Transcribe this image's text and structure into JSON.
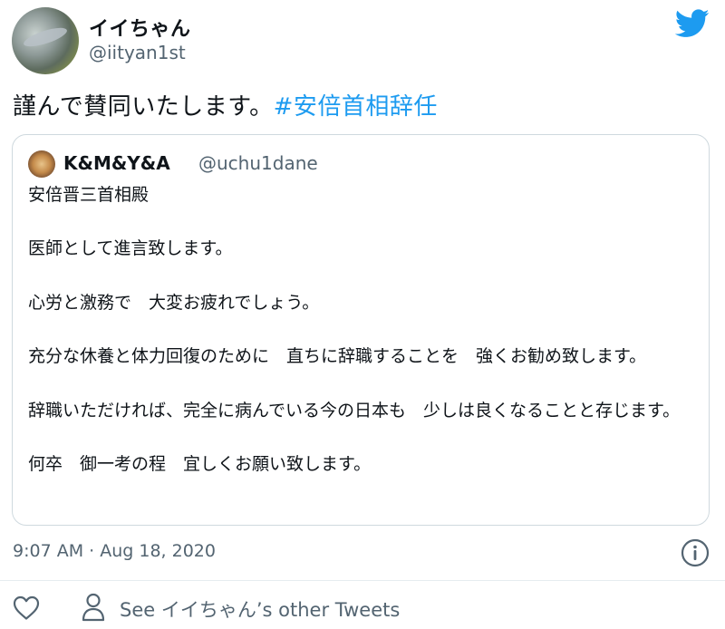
{
  "author": {
    "display_name": "イイちゃん",
    "handle": "@iityan1st"
  },
  "tweet": {
    "text": "謹んで賛同いたします。",
    "hashtag": "#安倍首相辞任"
  },
  "quoted_tweet": {
    "display_name": "K&M&Y&A",
    "handle": "@uchu1dane",
    "body": "安倍晋三首相殿\n\n医師として進言致します。\n\n心労と激務で　大変お疲れでしょう。\n\n充分な休養と体力回復のために　直ちに辞職することを　強くお勧め致します。\n\n辞職いただければ、完全に病んでいる今の日本も　少しは良くなることと存じます。\n\n何卒　御一考の程　宜しくお願い致します。"
  },
  "timestamp": "9:07 AM · Aug 18, 2020",
  "footer": {
    "see_tweets": "See イイちゃん’s other Tweets"
  },
  "icons": {
    "twitter": "twitter-bird-icon",
    "info": "info-icon",
    "like": "heart-icon",
    "profile": "person-icon"
  },
  "colors": {
    "brand": "#1d9bf0",
    "secondary_text": "#536471",
    "border": "#cfd9de"
  }
}
